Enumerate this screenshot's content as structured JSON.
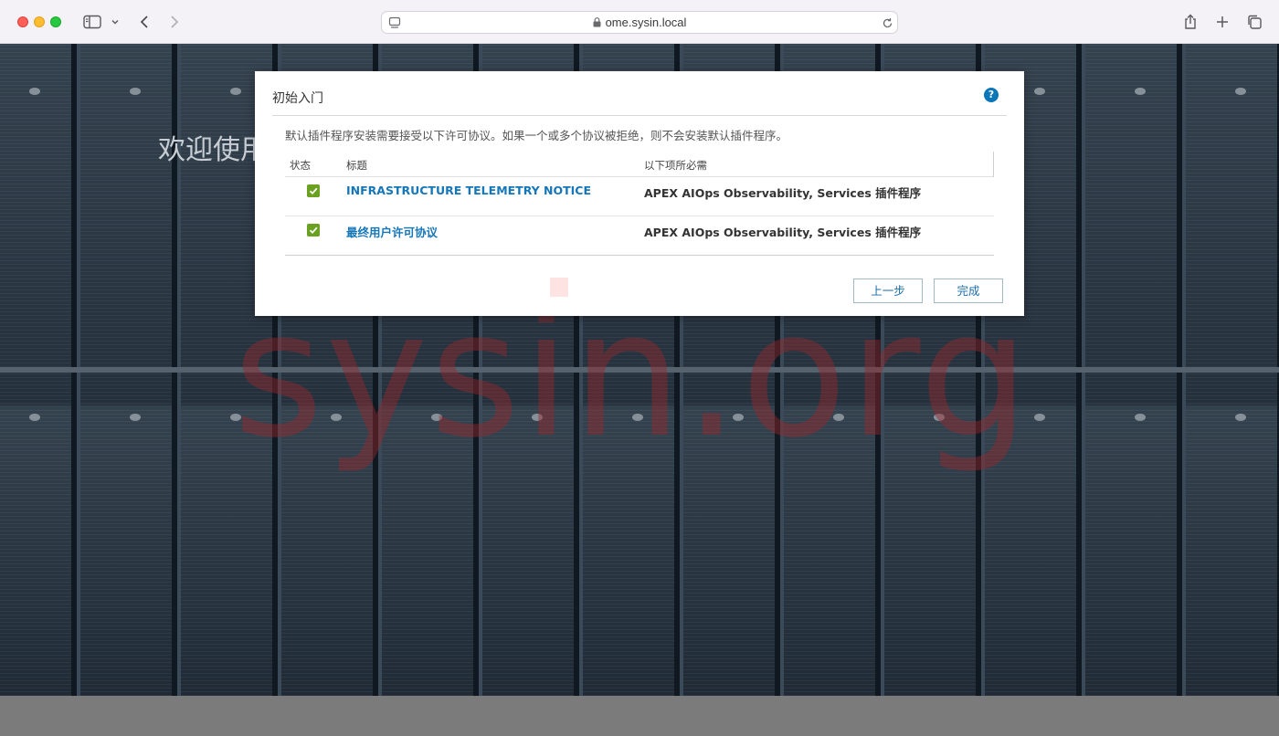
{
  "browser": {
    "url": "ome.sysin.local"
  },
  "page": {
    "welcome_text": "欢迎使用",
    "watermark": "sysin.org"
  },
  "dialog": {
    "title": "初始入门",
    "help_label": "?",
    "description": "默认插件程序安装需要接受以下许可协议。如果一个或多个协议被拒绝，则不会安装默认插件程序。",
    "columns": {
      "status": "状态",
      "title": "标题",
      "required_by": "以下项所必需"
    },
    "rows": [
      {
        "checked": true,
        "title": "INFRASTRUCTURE TELEMETRY NOTICE",
        "required_by": "APEX AIOps Observability, Services 插件程序"
      },
      {
        "checked": true,
        "title": "最终用户许可协议",
        "required_by": "APEX AIOps Observability, Services 插件程序"
      }
    ],
    "buttons": {
      "back": "上一步",
      "finish": "完成"
    }
  },
  "colors": {
    "link": "#1576b8",
    "checkbox": "#6aa121",
    "help": "#0b76b8"
  }
}
